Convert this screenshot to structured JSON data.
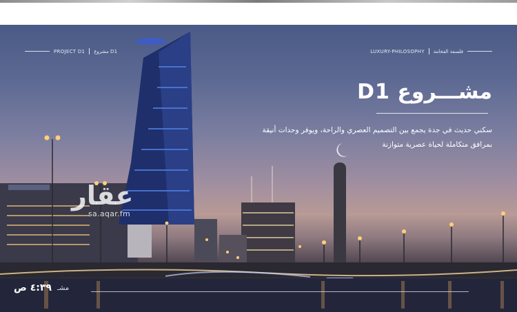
{
  "header_left": {
    "project_en": "PROJECT D1",
    "project_ar": "مشروع D1"
  },
  "header_right": {
    "philosophy_en": "LUXURY-PHILOSOPHY",
    "philosophy_ar": "فلسفة الفخامة"
  },
  "title": "مشـــروع D1",
  "description": "سكني حديث في جدة يجمع بين التصميم العصري والراحة، ويوفر وحدات أنيقة بمرافق متكاملة لحياة عصرية متوازنة",
  "watermark": {
    "brand": "عقار",
    "url": "sa.aqar.fm"
  },
  "footer": {
    "label": "مشـ",
    "time": "٤:٣٩ ص"
  },
  "colors": {
    "sky_top": "#4a5a86",
    "sky_horizon": "#b89a96",
    "water": "#1f2230",
    "tower_glass": "#2b3f86",
    "lamp": "#ffcf7a"
  }
}
